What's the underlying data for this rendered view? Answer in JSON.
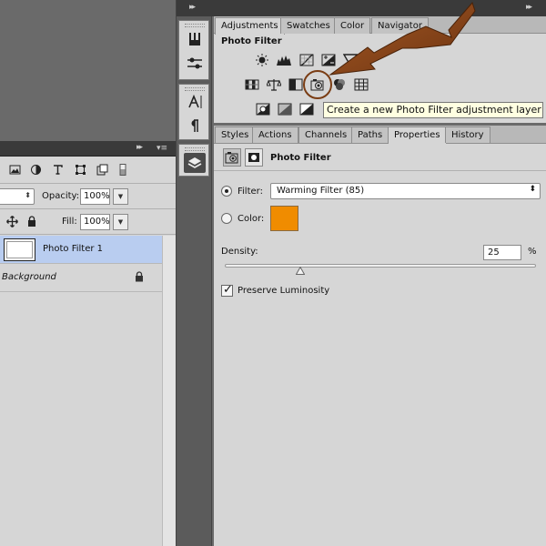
{
  "layers": {
    "opacity_label": "Opacity:",
    "opacity_value": "100%",
    "fill_label": "Fill:",
    "fill_value": "100%",
    "items": [
      {
        "name": "Photo Filter 1",
        "selected": true
      },
      {
        "name": "Background",
        "selected": false,
        "locked": true
      }
    ]
  },
  "adjustments": {
    "tabs": [
      "Adjustments",
      "Swatches",
      "Color",
      "Navigator"
    ],
    "active_tab": "Adjustments",
    "title": "Photo Filter",
    "tooltip": "Create a new Photo Filter adjustment layer",
    "icons_row1": [
      "brightness-contrast-icon",
      "levels-icon",
      "curves-icon",
      "exposure-icon",
      "vibrance-icon"
    ],
    "icons_row2": [
      "hue-saturation-icon",
      "color-balance-icon",
      "black-white-icon",
      "photo-filter-icon",
      "channel-mixer-icon",
      "color-lookup-icon"
    ],
    "icons_row3": [
      "invert-icon",
      "posterize-icon",
      "threshold-icon"
    ]
  },
  "properties": {
    "tabs": [
      "Styles",
      "Actions",
      "Channels",
      "Paths",
      "Properties",
      "History"
    ],
    "active_tab": "Properties",
    "title": "Photo Filter",
    "filter_label": "Filter:",
    "filter_value": "Warming Filter (85)",
    "color_label": "Color:",
    "color_value": "#f08c00",
    "density_label": "Density:",
    "density_value": "25",
    "density_unit": "%",
    "density_fraction": 0.25,
    "preserve_label": "Preserve Luminosity",
    "preserve_checked": true
  },
  "colors": {
    "panel_bg": "#d6d6d6",
    "dark_bar": "#3a3a3a",
    "selection": "#b9cdf0",
    "arrow": "#7a3d14"
  }
}
